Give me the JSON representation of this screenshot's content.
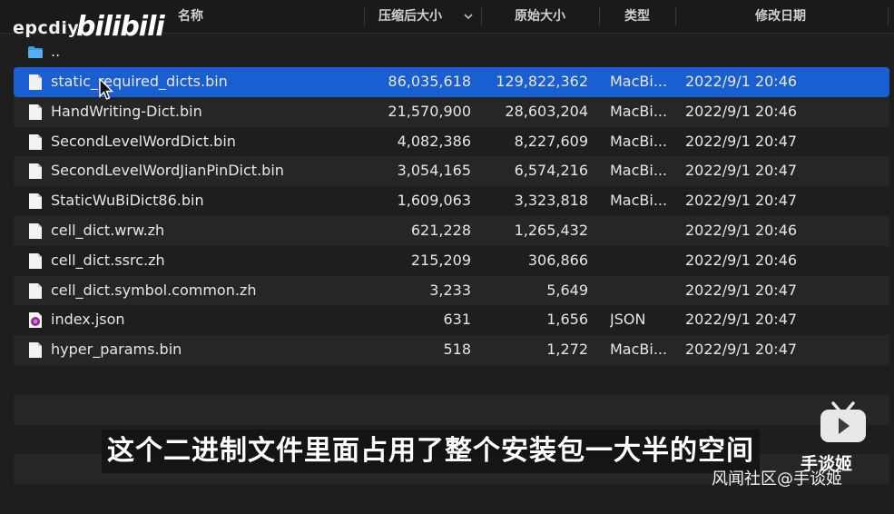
{
  "columns": {
    "name": "名称",
    "compressed": "压缩后大小",
    "original": "原始大小",
    "kind": "类型",
    "modified": "修改日期"
  },
  "watermark": {
    "channel": "epcdiy",
    "brand": "bilibili"
  },
  "parent_folder": "..",
  "files": [
    {
      "name": "static_required_dicts.bin",
      "compressed": "86,035,618",
      "original": "129,822,362",
      "kind": "MacBi...",
      "modified": "2022/9/1 20:46",
      "icon": "document-icon",
      "selected": true
    },
    {
      "name": "HandWriting-Dict.bin",
      "compressed": "21,570,900",
      "original": "28,603,204",
      "kind": "MacBi...",
      "modified": "2022/9/1 20:46",
      "icon": "document-icon",
      "selected": false
    },
    {
      "name": "SecondLevelWordDict.bin",
      "compressed": "4,082,386",
      "original": "8,227,609",
      "kind": "MacBi...",
      "modified": "2022/9/1 20:47",
      "icon": "document-icon",
      "selected": false
    },
    {
      "name": "SecondLevelWordJianPinDict.bin",
      "compressed": "3,054,165",
      "original": "6,574,216",
      "kind": "MacBi...",
      "modified": "2022/9/1 20:47",
      "icon": "document-icon",
      "selected": false
    },
    {
      "name": "StaticWuBiDict86.bin",
      "compressed": "1,609,063",
      "original": "3,323,818",
      "kind": "MacBi...",
      "modified": "2022/9/1 20:47",
      "icon": "document-icon",
      "selected": false
    },
    {
      "name": "cell_dict.wrw.zh",
      "compressed": "621,228",
      "original": "1,265,432",
      "kind": "",
      "modified": "2022/9/1 20:46",
      "icon": "blank-file-icon",
      "selected": false
    },
    {
      "name": "cell_dict.ssrc.zh",
      "compressed": "215,209",
      "original": "306,866",
      "kind": "",
      "modified": "2022/9/1 20:46",
      "icon": "blank-file-icon",
      "selected": false
    },
    {
      "name": "cell_dict.symbol.common.zh",
      "compressed": "3,233",
      "original": "5,649",
      "kind": "",
      "modified": "2022/9/1 20:47",
      "icon": "blank-file-icon",
      "selected": false
    },
    {
      "name": "index.json",
      "compressed": "631",
      "original": "1,656",
      "kind": "JSON",
      "modified": "2022/9/1 20:47",
      "icon": "json-file-icon",
      "selected": false
    },
    {
      "name": "hyper_params.bin",
      "compressed": "518",
      "original": "1,272",
      "kind": "MacBi...",
      "modified": "2022/9/1 20:47",
      "icon": "document-icon",
      "selected": false
    }
  ],
  "subtitle": "这个二进制文件里面占用了整个安装包一大半的空间",
  "uploader": "手谈姬",
  "community": "风闻社区@手谈姬",
  "colors": {
    "selection": "#1a5fd1",
    "background": "#1e1e1e",
    "alt_row": "#262626"
  }
}
